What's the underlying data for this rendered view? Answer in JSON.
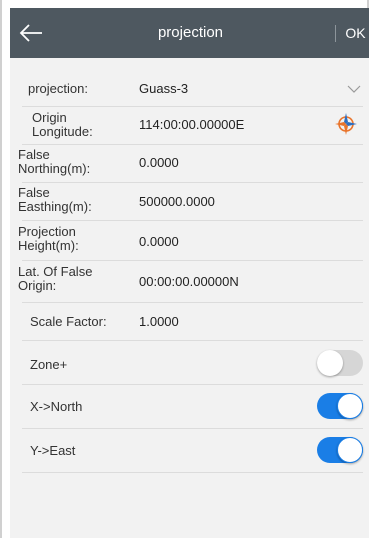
{
  "header": {
    "title": "projection",
    "ok_label": "OK"
  },
  "fields": [
    {
      "label": "projection:",
      "value": "Guass-3"
    },
    {
      "label": "Origin Longitude:",
      "value": "114:00:00.00000E"
    },
    {
      "label": "False Northing(m):",
      "value": "0.0000"
    },
    {
      "label": "False Easthing(m):",
      "value": "500000.0000"
    },
    {
      "label": "Projection Height(m):",
      "value": "0.0000"
    },
    {
      "label": "Lat. Of False Origin:",
      "value": "00:00:00.00000N"
    },
    {
      "label": "Scale Factor:",
      "value": "1.0000"
    }
  ],
  "toggles": [
    {
      "label": "Zone+",
      "checked": false
    },
    {
      "label": "X->North",
      "checked": true
    },
    {
      "label": "Y->East",
      "checked": true
    }
  ],
  "colors": {
    "header_bg": "#4e5860",
    "toggle_on": "#1a7ee6",
    "toggle_off": "#d6d6d6",
    "content_bg": "#f2f2f2"
  },
  "icons": {
    "back": "arrow-left-icon",
    "dropdown": "chevron-down-icon",
    "locate": "compass-locate-icon"
  }
}
